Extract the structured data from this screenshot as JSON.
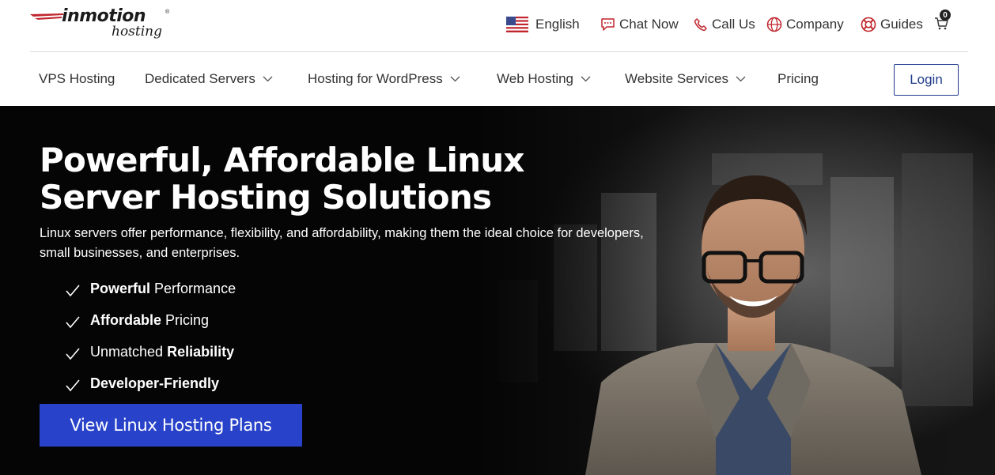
{
  "logo": {
    "main": "inmotion",
    "sub": "hosting",
    "reg": "®"
  },
  "utility": {
    "language": "English",
    "chat": "Chat Now",
    "call": "Call Us",
    "company": "Company",
    "guides": "Guides",
    "cart_count": "0"
  },
  "nav": {
    "items": [
      {
        "label": "VPS Hosting",
        "dropdown": false
      },
      {
        "label": "Dedicated Servers",
        "dropdown": true
      },
      {
        "label": "Hosting for WordPress",
        "dropdown": true
      },
      {
        "label": "Web Hosting",
        "dropdown": true
      },
      {
        "label": "Website Services",
        "dropdown": true
      },
      {
        "label": "Pricing",
        "dropdown": false
      }
    ],
    "login": "Login"
  },
  "hero": {
    "title": "Powerful, Affordable Linux Server Hosting Solutions",
    "subtitle": "Linux servers offer performance, flexibility, and affordability, making them the ideal choice for developers, small businesses, and enterprises.",
    "features": [
      {
        "bold_first": true,
        "bold": "Powerful",
        "normal": "Performance"
      },
      {
        "bold_first": true,
        "bold": "Affordable",
        "normal": "Pricing"
      },
      {
        "bold_first": false,
        "normal": "Unmatched",
        "bold": "Reliability"
      },
      {
        "bold_first": true,
        "bold": "Developer-Friendly",
        "normal": ""
      }
    ],
    "cta": "View Linux Hosting Plans"
  },
  "icons": {
    "flag": "us-flag-icon",
    "chat": "chat-bubble-icon",
    "call": "phone-icon",
    "company": "globe-icon",
    "guides": "lifebuoy-icon",
    "cart": "cart-icon",
    "chevron": "chevron-down-icon",
    "check": "checkmark-icon"
  },
  "colors": {
    "accent": "#2843c9",
    "login_border": "#1f3a8a",
    "icon_red": "#c0262d",
    "hero_bg": "#050505"
  }
}
